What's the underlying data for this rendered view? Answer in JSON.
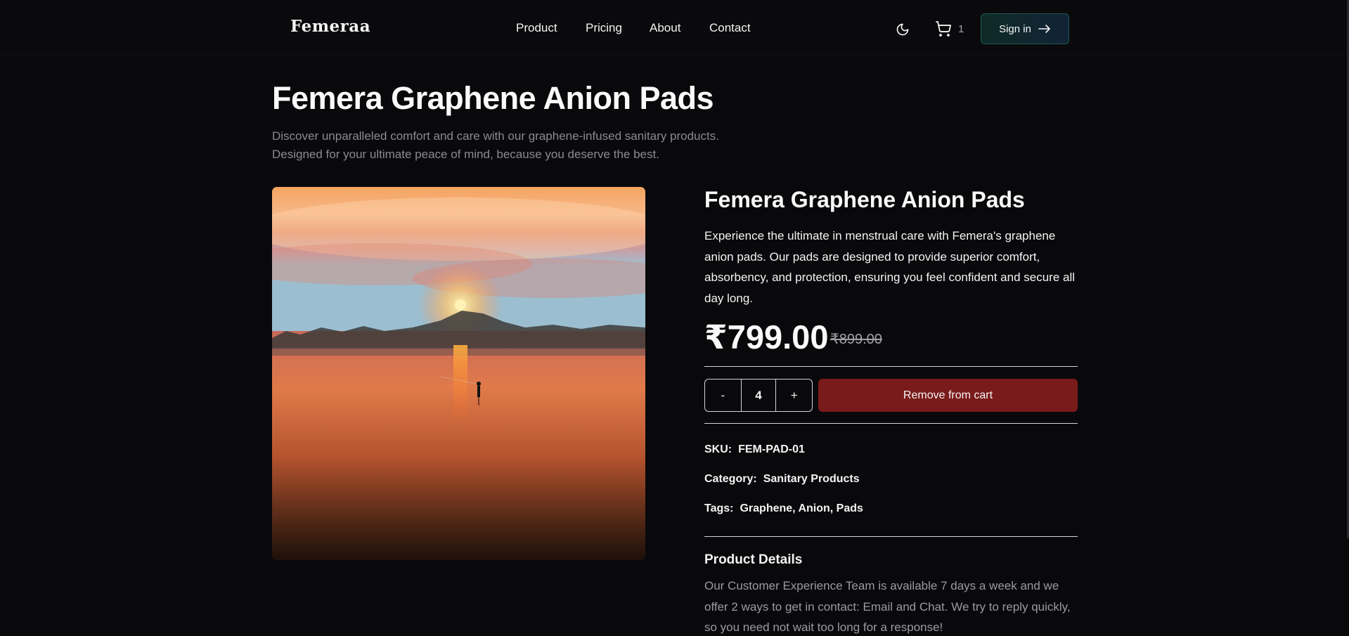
{
  "header": {
    "logo": "Femeraa",
    "nav": [
      "Product",
      "Pricing",
      "About",
      "Contact"
    ],
    "cart_count": "1",
    "sign_in_label": "Sign in",
    "icons": {
      "theme": "moon-icon",
      "cart": "cart-icon",
      "signin": "arrow-right-icon"
    }
  },
  "hero": {
    "title": "Femera Graphene Anion Pads",
    "subtitle_line1": "Discover unparalleled comfort and care with our graphene-infused sanitary products.",
    "subtitle_line2": "Designed for your ultimate peace of mind, because you deserve the best."
  },
  "product": {
    "name": "Femera Graphene Anion Pads",
    "description": "Experience the ultimate in menstrual care with Femera's graphene anion pads. Our pads are designed to provide superior comfort, absorbency, and protection, ensuring you feel confident and secure all day long.",
    "price": "₹799.00",
    "old_price": "₹899.00",
    "quantity": {
      "minus_label": "-",
      "value": "4",
      "plus_label": "+"
    },
    "remove_label": "Remove from cart",
    "sku_label": "SKU:",
    "sku": "FEM-PAD-01",
    "category_label": "Category:",
    "category": "Sanitary Products",
    "tags_label": "Tags:",
    "tags": "Graphene, Anion, Pads",
    "details_title": "Product Details",
    "details_text": "Our Customer Experience Team is available 7 days a week and we offer 2 ways to get in contact: Email and Chat. We try to reply quickly, so you need not wait too long for a response!"
  },
  "colors": {
    "background": "#09090b",
    "remove_button": "#7a1b1b",
    "signin_border": "#1f5a4f"
  }
}
